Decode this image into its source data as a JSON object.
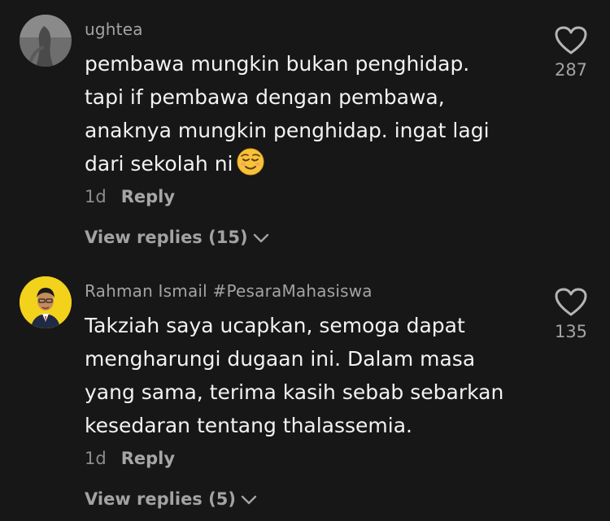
{
  "comments": [
    {
      "username": "ughtea",
      "text": "pembawa mungkin bukan penghidap.\ntapi if pembawa dengan pembawa,\nanaknya mungkin penghidap. ingat lagi\ndari sekolah ni",
      "emoji": "relieved-face",
      "age": "1d",
      "reply_label": "Reply",
      "view_replies": "View replies (15)",
      "likes": "287"
    },
    {
      "username": "Rahman Ismail #PesaraMahasiswa",
      "text": "Takziah saya ucapkan, semoga dapat\nmengharungi dugaan ini. Dalam masa\nyang sama, terima kasih sebab sebarkan\nkesedaran tentang thalassemia.",
      "age": "1d",
      "reply_label": "Reply",
      "view_replies": "View replies (5)",
      "likes": "135"
    }
  ],
  "colors": {
    "background": "#171717",
    "text": "#f2f2f2",
    "muted": "#a3a3a3",
    "avatar2_bg": "#f2d21b"
  }
}
